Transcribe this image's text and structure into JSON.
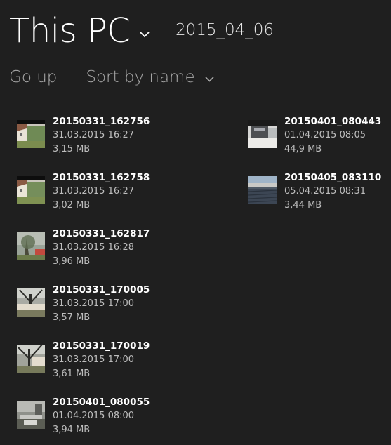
{
  "header": {
    "title": "This PC",
    "folder": "2015_04_06",
    "title_chevron_icon": "chevron-down-icon"
  },
  "toolbar": {
    "go_up_label": "Go up",
    "sort_label": "Sort by name",
    "sort_chevron_icon": "chevron-down-icon"
  },
  "files": [
    {
      "name": "20150331_162756",
      "date": "31.03.2015 16:27",
      "size": "3,15 MB",
      "thumb": "house-photo"
    },
    {
      "name": "20150331_162758",
      "date": "31.03.2015 16:27",
      "size": "3,02 MB",
      "thumb": "house-photo"
    },
    {
      "name": "20150331_162817",
      "date": "31.03.2015 16:28",
      "size": "3,96 MB",
      "thumb": "tree-photo"
    },
    {
      "name": "20150331_170005",
      "date": "31.03.2015 17:00",
      "size": "3,57 MB",
      "thumb": "yard-photo"
    },
    {
      "name": "20150331_170019",
      "date": "31.03.2015 17:00",
      "size": "3,61 MB",
      "thumb": "yard-photo"
    },
    {
      "name": "20150401_080055",
      "date": "01.04.2015 08:00",
      "size": "3,94 MB",
      "thumb": "street-photo"
    },
    {
      "name": "20150401_080443",
      "date": "01.04.2015 08:05",
      "size": "44,9 MB",
      "thumb": "building-photo"
    },
    {
      "name": "20150405_083110",
      "date": "05.04.2015 08:31",
      "size": "3,44 MB",
      "thumb": "roof-photo"
    }
  ],
  "colors": {
    "background": "#1f1f1f",
    "text_primary": "#ffffff",
    "text_secondary": "#bdbdbd",
    "toolbar_text": "#a6a6a6"
  }
}
